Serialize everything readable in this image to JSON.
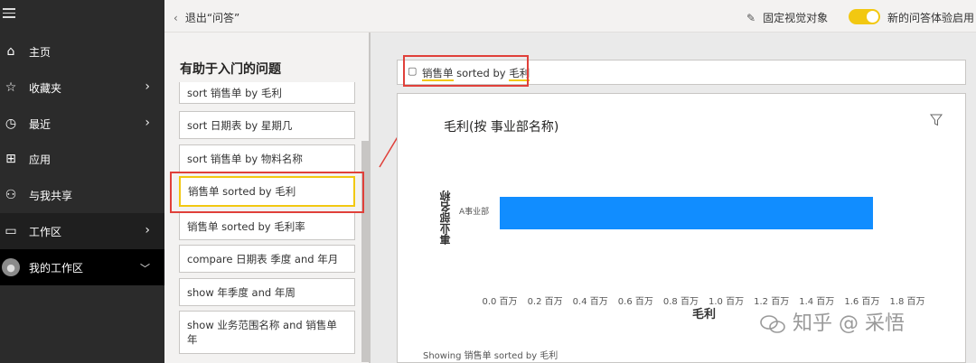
{
  "nav": {
    "items": [
      {
        "label": "主页"
      },
      {
        "label": "收藏夹"
      },
      {
        "label": "最近"
      },
      {
        "label": "应用"
      },
      {
        "label": "与我共享"
      },
      {
        "label": "工作区"
      },
      {
        "label": "我的工作区"
      }
    ]
  },
  "topbar": {
    "exit_label": "退出“问答”",
    "pin_label": "固定视觉对象",
    "new_experience_label": "新的问答体验启用",
    "toggle_on": true
  },
  "questions": {
    "title": "有助于入门的问题",
    "items": [
      "sort 销售单 by 毛利",
      "sort 日期表 by 星期几",
      "sort 销售单 by 物料名称",
      "销售单 sorted by 毛利",
      "销售单 sorted by 毛利率",
      "compare 日期表 季度 and 年月",
      "show 年季度 and 年周",
      "show 业务范围名称 and 销售单年"
    ],
    "selected_index": 3
  },
  "query": {
    "part1": "销售单",
    "part2": " sorted by ",
    "part3": "毛利"
  },
  "chart_title": "毛利(按 事业部名称)",
  "showing": "Showing 销售单 sorted by 毛利",
  "watermark": "知乎 @ 采悟",
  "colors": {
    "bar": "#118dff",
    "accent": "#f2c811",
    "annotation": "#e0403a"
  },
  "chart_data": {
    "type": "bar",
    "orientation": "horizontal",
    "categories": [
      "A事业部"
    ],
    "series": [
      {
        "values": [
          1.65
        ]
      }
    ],
    "xlabel": "毛利",
    "ylabel": "事业部名称",
    "xlim": [
      0,
      1.8
    ],
    "unit": "百万",
    "xticks": [
      "0.0 百万",
      "0.2 百万",
      "0.4 百万",
      "0.6 百万",
      "0.8 百万",
      "1.0 百万",
      "1.2 百万",
      "1.4 百万",
      "1.6 百万",
      "1.8 百万"
    ]
  }
}
